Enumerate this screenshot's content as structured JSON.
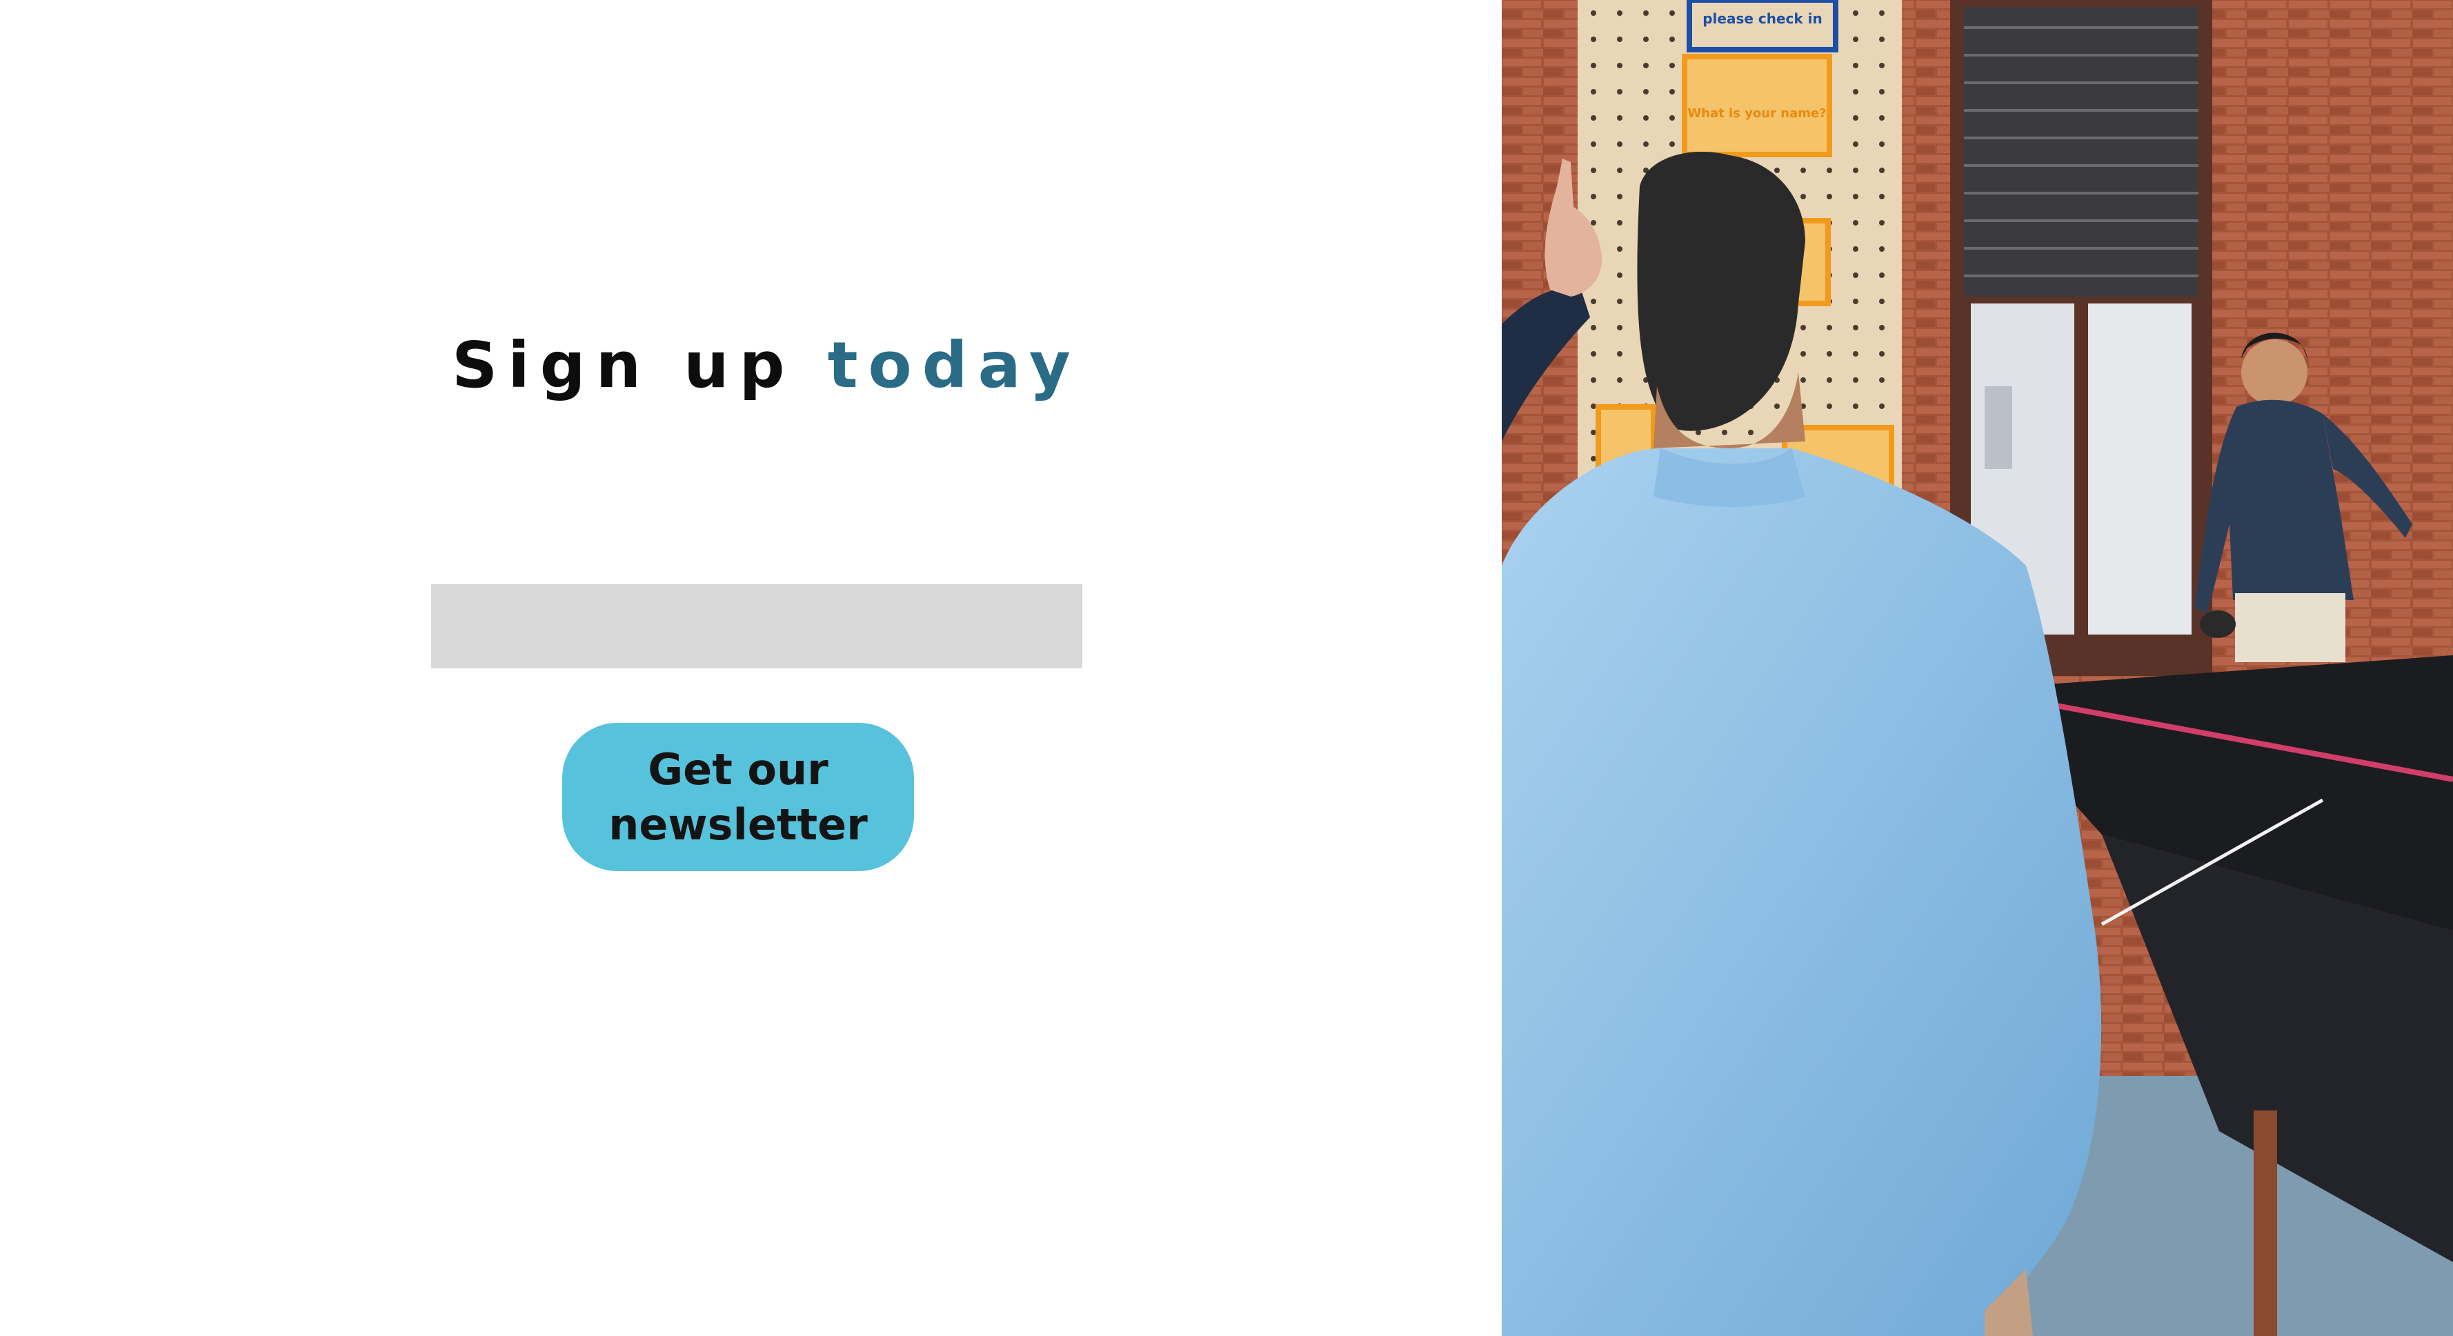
{
  "headline": {
    "word1": "Sign up",
    "word2": "today"
  },
  "newsletter_form": {
    "email_value": "",
    "email_placeholder": "",
    "button_label": "Get our newsletter"
  },
  "colors": {
    "accent_text": "#2a6b86",
    "button_bg": "#56c2db",
    "input_bg": "#d8d8d8"
  },
  "photo": {
    "signs": [
      "please check in",
      "What is your name?"
    ]
  }
}
